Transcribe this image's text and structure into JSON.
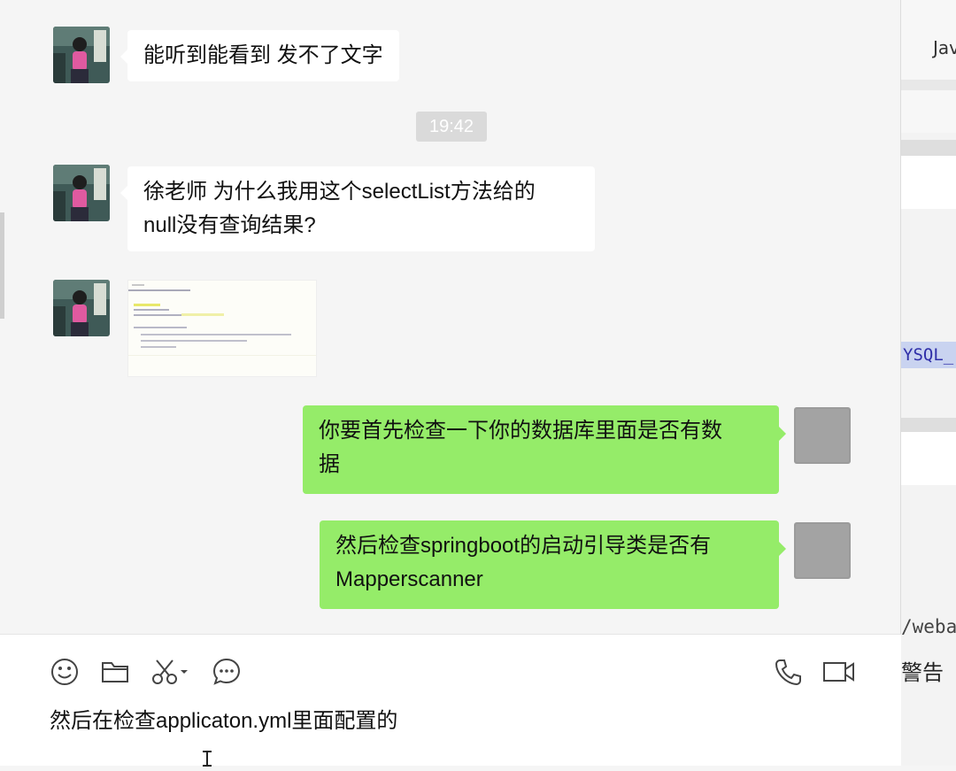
{
  "chat": {
    "messages": [
      {
        "type": "text",
        "from": "other",
        "text": "能听到能看到  发不了文字"
      },
      {
        "type": "time",
        "text": "19:42"
      },
      {
        "type": "text",
        "from": "other",
        "lines": [
          "徐老师  为什么我用这个selectList方法给的",
          "null没有查询结果?"
        ]
      },
      {
        "type": "image",
        "from": "other"
      },
      {
        "type": "text",
        "from": "me",
        "lines": [
          "你要首先检查一下你的数据库里面是否有数",
          "据"
        ]
      },
      {
        "type": "text",
        "from": "me",
        "lines": [
          "然后检查springboot的启动引导类是否有",
          "Mapperscanner"
        ]
      }
    ]
  },
  "composer": {
    "tools": [
      "emoji-icon",
      "folder-icon",
      "scissors-icon",
      "chat-bubble-icon"
    ],
    "call_tools": [
      "phone-icon",
      "video-icon"
    ],
    "input_text": "然后在检查applicaton.yml里面配置的"
  },
  "background_window": {
    "texts": [
      "Jav",
      "YSQL_",
      "/weba",
      "警告"
    ]
  },
  "colors": {
    "incoming_bubble": "#ffffff",
    "outgoing_bubble": "#95ec69",
    "chat_bg": "#f5f5f5"
  }
}
